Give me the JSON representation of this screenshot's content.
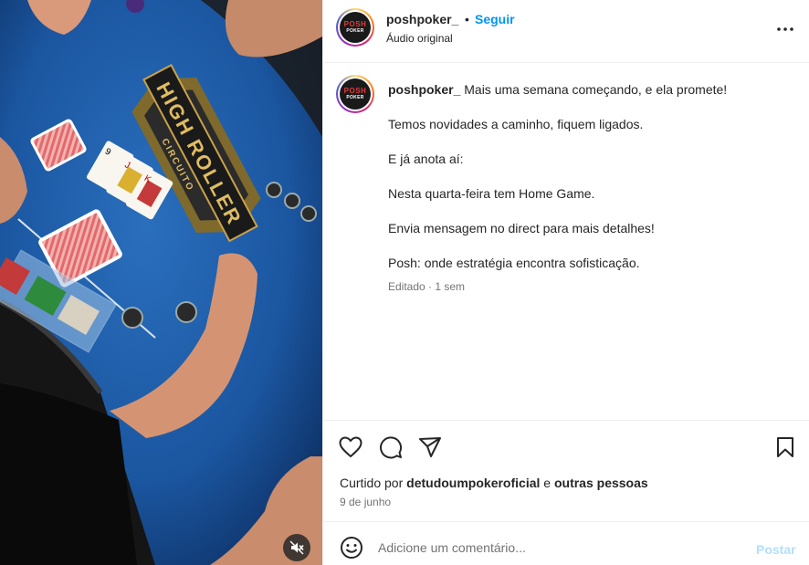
{
  "post": {
    "username": "poshpoker_",
    "follow_label": "Seguir",
    "separator": "•",
    "audio_label": "Áudio original",
    "avatar_logo_top": "POSH",
    "avatar_logo_bottom": "POKER"
  },
  "caption": {
    "username": "poshpoker_",
    "lines": [
      "Mais uma semana começando, e ela promete!",
      "Temos novidades a caminho, fiquem ligados.",
      "E já anota aí:",
      "Nesta quarta-feira tem Home Game.",
      "Envia mensagem no direct para mais detalhes!",
      "Posh: onde estratégia encontra sofisticação."
    ],
    "meta": "Editado · 1 sem"
  },
  "media": {
    "table_logo_line1": "HIGH ROLLER",
    "table_logo_line2": "CIRCUITO"
  },
  "engagement": {
    "liked_prefix": "Curtido por",
    "liked_user": "detudoumpokeroficial",
    "liked_join": "e",
    "liked_others": "outras pessoas",
    "date": "9 de junho"
  },
  "comment": {
    "placeholder": "Adicione um comentário...",
    "post_label": "Postar"
  },
  "icons": {
    "like": "heart-icon",
    "comment": "comment-icon",
    "share": "share-icon",
    "save": "bookmark-icon",
    "more": "more-icon",
    "emoji": "emoji-icon",
    "mute": "mute-icon"
  },
  "colors": {
    "link": "#0095f6",
    "post_disabled": "#b2dffc",
    "table_felt": "#1f5fa8"
  }
}
